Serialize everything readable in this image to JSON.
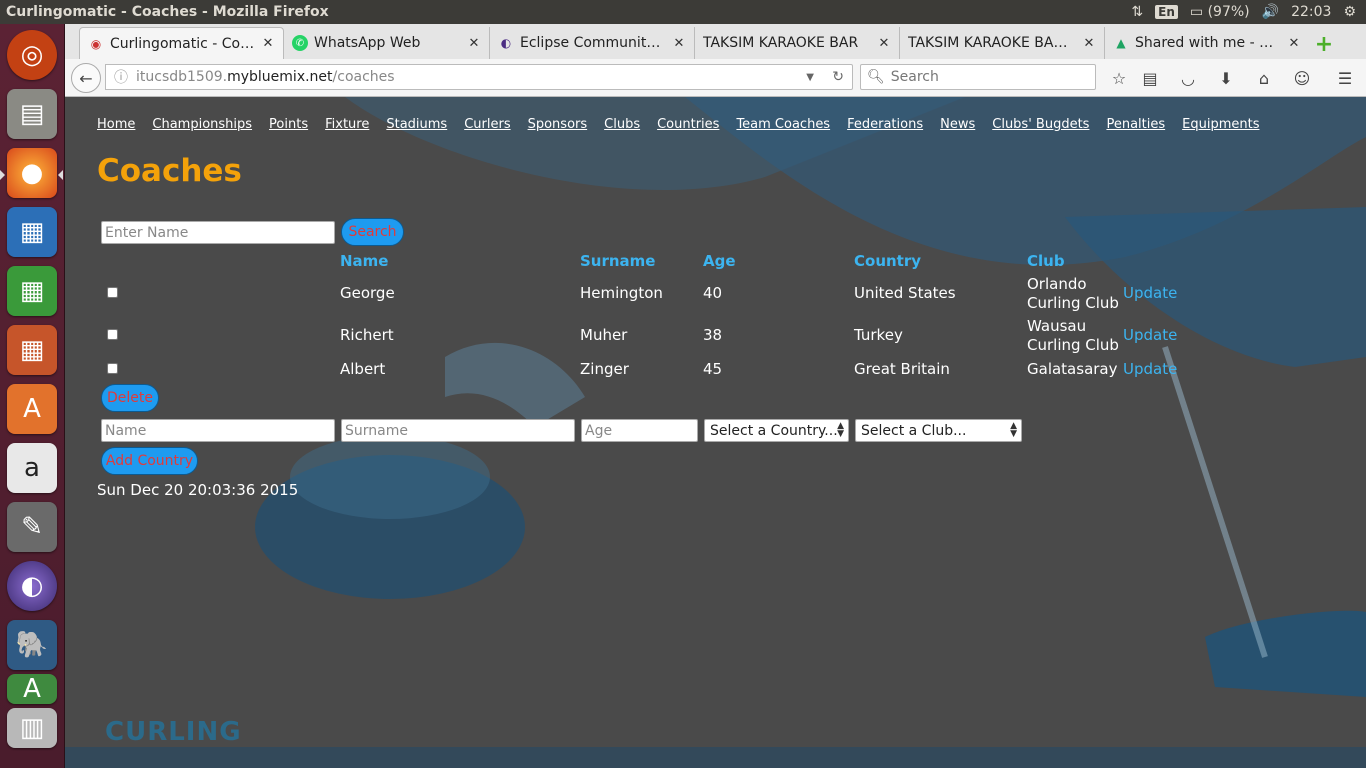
{
  "window": {
    "title": "Curlingomatic - Coaches - Mozilla Firefox",
    "keyboard": "En",
    "battery": "(97%)",
    "clock": "22:03"
  },
  "tabs": [
    {
      "label": "Curlingomatic - Coa…",
      "icon": "curling-favicon-icon",
      "active": true
    },
    {
      "label": "WhatsApp Web",
      "icon": "whatsapp-icon",
      "active": false
    },
    {
      "label": "Eclipse Community …",
      "icon": "eclipse-icon",
      "active": false
    },
    {
      "label": "TAKSIM KARAOKE BAR",
      "icon": "none",
      "active": false
    },
    {
      "label": "TAKSIM KARAOKE BAR…",
      "icon": "none",
      "active": false
    },
    {
      "label": "Shared with me - Go…",
      "icon": "google-drive-icon",
      "active": false
    }
  ],
  "url": {
    "prefix": "itucsdb1509.",
    "host": "mybluemix.net",
    "path": "/coaches"
  },
  "search": {
    "placeholder": "Search"
  },
  "nav": [
    "Home",
    "Championships",
    "Points",
    "Fixture",
    "Stadiums",
    "Curlers",
    "Sponsors",
    "Clubs",
    "Countries",
    "Team Coaches",
    "Federations",
    "News",
    "Clubs' Bugdets",
    "Penalties",
    "Equipments"
  ],
  "page": {
    "title": "Coaches",
    "search_placeholder": "Enter Name",
    "search_button": "Search",
    "delete_button": "Delete",
    "add_button": "Add Country",
    "timestamp": "Sun Dec 20 20:03:36 2015",
    "logo_text": "CURLING"
  },
  "table": {
    "headers": [
      "Name",
      "Surname",
      "Age",
      "Country",
      "Club"
    ],
    "rows": [
      {
        "name": "George",
        "surname": "Hemington",
        "age": "40",
        "country": "United States",
        "club": "Orlando Curling Club",
        "action": "Update"
      },
      {
        "name": "Richert",
        "surname": "Muher",
        "age": "38",
        "country": "Turkey",
        "club": "Wausau Curling Club",
        "action": "Update"
      },
      {
        "name": "Albert",
        "surname": "Zinger",
        "age": "45",
        "country": "Great Britain",
        "club": "Galatasaray",
        "action": "Update"
      }
    ]
  },
  "form": {
    "name_placeholder": "Name",
    "surname_placeholder": "Surname",
    "age_placeholder": "Age",
    "country_select": "Select a Country...",
    "club_select": "Select a Club..."
  }
}
